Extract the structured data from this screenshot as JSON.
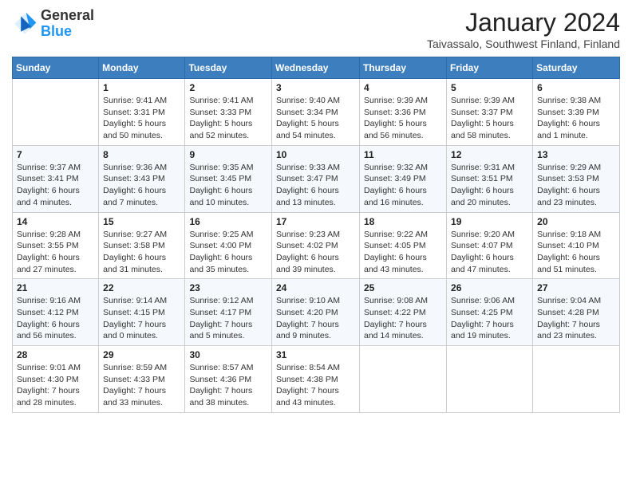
{
  "logo": {
    "general": "General",
    "blue": "Blue"
  },
  "header": {
    "title": "January 2024",
    "location": "Taivassalo, Southwest Finland, Finland"
  },
  "weekdays": [
    "Sunday",
    "Monday",
    "Tuesday",
    "Wednesday",
    "Thursday",
    "Friday",
    "Saturday"
  ],
  "weeks": [
    [
      {
        "day": "",
        "info": ""
      },
      {
        "day": "1",
        "info": "Sunrise: 9:41 AM\nSunset: 3:31 PM\nDaylight: 5 hours\nand 50 minutes."
      },
      {
        "day": "2",
        "info": "Sunrise: 9:41 AM\nSunset: 3:33 PM\nDaylight: 5 hours\nand 52 minutes."
      },
      {
        "day": "3",
        "info": "Sunrise: 9:40 AM\nSunset: 3:34 PM\nDaylight: 5 hours\nand 54 minutes."
      },
      {
        "day": "4",
        "info": "Sunrise: 9:39 AM\nSunset: 3:36 PM\nDaylight: 5 hours\nand 56 minutes."
      },
      {
        "day": "5",
        "info": "Sunrise: 9:39 AM\nSunset: 3:37 PM\nDaylight: 5 hours\nand 58 minutes."
      },
      {
        "day": "6",
        "info": "Sunrise: 9:38 AM\nSunset: 3:39 PM\nDaylight: 6 hours\nand 1 minute."
      }
    ],
    [
      {
        "day": "7",
        "info": "Sunrise: 9:37 AM\nSunset: 3:41 PM\nDaylight: 6 hours\nand 4 minutes."
      },
      {
        "day": "8",
        "info": "Sunrise: 9:36 AM\nSunset: 3:43 PM\nDaylight: 6 hours\nand 7 minutes."
      },
      {
        "day": "9",
        "info": "Sunrise: 9:35 AM\nSunset: 3:45 PM\nDaylight: 6 hours\nand 10 minutes."
      },
      {
        "day": "10",
        "info": "Sunrise: 9:33 AM\nSunset: 3:47 PM\nDaylight: 6 hours\nand 13 minutes."
      },
      {
        "day": "11",
        "info": "Sunrise: 9:32 AM\nSunset: 3:49 PM\nDaylight: 6 hours\nand 16 minutes."
      },
      {
        "day": "12",
        "info": "Sunrise: 9:31 AM\nSunset: 3:51 PM\nDaylight: 6 hours\nand 20 minutes."
      },
      {
        "day": "13",
        "info": "Sunrise: 9:29 AM\nSunset: 3:53 PM\nDaylight: 6 hours\nand 23 minutes."
      }
    ],
    [
      {
        "day": "14",
        "info": "Sunrise: 9:28 AM\nSunset: 3:55 PM\nDaylight: 6 hours\nand 27 minutes."
      },
      {
        "day": "15",
        "info": "Sunrise: 9:27 AM\nSunset: 3:58 PM\nDaylight: 6 hours\nand 31 minutes."
      },
      {
        "day": "16",
        "info": "Sunrise: 9:25 AM\nSunset: 4:00 PM\nDaylight: 6 hours\nand 35 minutes."
      },
      {
        "day": "17",
        "info": "Sunrise: 9:23 AM\nSunset: 4:02 PM\nDaylight: 6 hours\nand 39 minutes."
      },
      {
        "day": "18",
        "info": "Sunrise: 9:22 AM\nSunset: 4:05 PM\nDaylight: 6 hours\nand 43 minutes."
      },
      {
        "day": "19",
        "info": "Sunrise: 9:20 AM\nSunset: 4:07 PM\nDaylight: 6 hours\nand 47 minutes."
      },
      {
        "day": "20",
        "info": "Sunrise: 9:18 AM\nSunset: 4:10 PM\nDaylight: 6 hours\nand 51 minutes."
      }
    ],
    [
      {
        "day": "21",
        "info": "Sunrise: 9:16 AM\nSunset: 4:12 PM\nDaylight: 6 hours\nand 56 minutes."
      },
      {
        "day": "22",
        "info": "Sunrise: 9:14 AM\nSunset: 4:15 PM\nDaylight: 7 hours\nand 0 minutes."
      },
      {
        "day": "23",
        "info": "Sunrise: 9:12 AM\nSunset: 4:17 PM\nDaylight: 7 hours\nand 5 minutes."
      },
      {
        "day": "24",
        "info": "Sunrise: 9:10 AM\nSunset: 4:20 PM\nDaylight: 7 hours\nand 9 minutes."
      },
      {
        "day": "25",
        "info": "Sunrise: 9:08 AM\nSunset: 4:22 PM\nDaylight: 7 hours\nand 14 minutes."
      },
      {
        "day": "26",
        "info": "Sunrise: 9:06 AM\nSunset: 4:25 PM\nDaylight: 7 hours\nand 19 minutes."
      },
      {
        "day": "27",
        "info": "Sunrise: 9:04 AM\nSunset: 4:28 PM\nDaylight: 7 hours\nand 23 minutes."
      }
    ],
    [
      {
        "day": "28",
        "info": "Sunrise: 9:01 AM\nSunset: 4:30 PM\nDaylight: 7 hours\nand 28 minutes."
      },
      {
        "day": "29",
        "info": "Sunrise: 8:59 AM\nSunset: 4:33 PM\nDaylight: 7 hours\nand 33 minutes."
      },
      {
        "day": "30",
        "info": "Sunrise: 8:57 AM\nSunset: 4:36 PM\nDaylight: 7 hours\nand 38 minutes."
      },
      {
        "day": "31",
        "info": "Sunrise: 8:54 AM\nSunset: 4:38 PM\nDaylight: 7 hours\nand 43 minutes."
      },
      {
        "day": "",
        "info": ""
      },
      {
        "day": "",
        "info": ""
      },
      {
        "day": "",
        "info": ""
      }
    ]
  ]
}
